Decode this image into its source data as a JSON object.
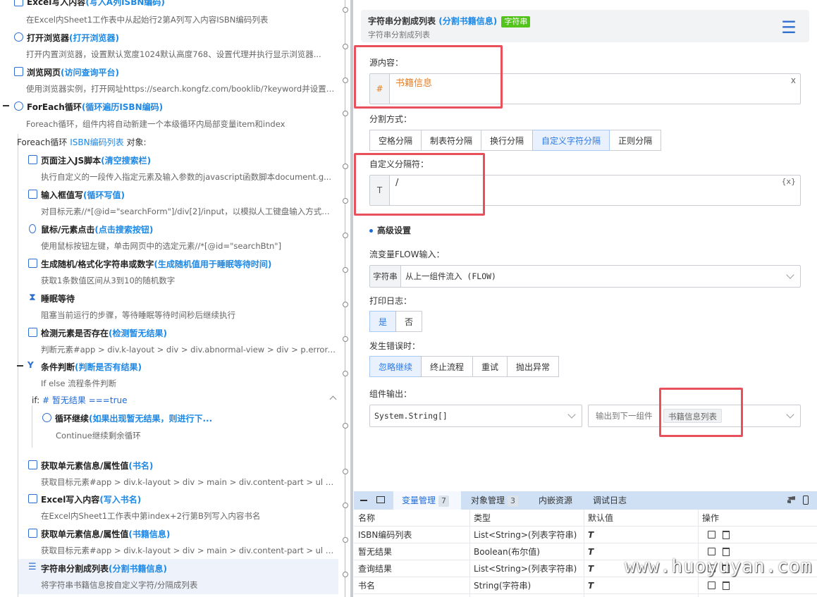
{
  "left_steps": [
    {
      "title": "Excel写入内容",
      "alias": "(写入A列ISBN编码)",
      "desc": "在Excel内Sheet1工作表中从起始行2第A列写入内容ISBN编码列表",
      "icon": "excel-icon"
    },
    {
      "title": "打开浏览器",
      "alias": "(打开浏览器)",
      "desc": "打开内置浏览器，设置默认宽度1024默认高度768、设置代理并执行显示浏览器...",
      "icon": "compass-icon"
    },
    {
      "title": "浏览网页",
      "alias": "(访问查询平台)",
      "desc": "使用浏览器实例，打开网址https://search.kongfz.com/booklib/?keyword并设置U...",
      "icon": "browser-icon"
    },
    {
      "title": "ForEach循环",
      "alias": "(循环遍历ISBN编码)",
      "desc": "Foreach循环，组件内将自动新建一个本级循环内局部变量item和index",
      "icon": "loop-icon"
    }
  ],
  "foreach_object": {
    "prefix": "Foreach循环",
    "var": "ISBN编码列表",
    "suffix": "对象:"
  },
  "inner_steps": [
    {
      "title": "页面注入JS脚本",
      "alias": "(清空搜索栏)",
      "desc": "执行自定义的一段传入指定元素及输入参数的javascript函数脚本document.g...",
      "icon": "script-icon"
    },
    {
      "title": "输入框值写",
      "alias": "(循环写值)",
      "desc": "对目标元素//*[@id=\"searchForm\"]/div[2]/input，以模拟人工键盘输入方式写...",
      "icon": "input-icon"
    },
    {
      "title": "鼠标/元素点击",
      "alias": "(点击搜索按钮)",
      "desc": "使用鼠标按钮左键，单击网页中的选定元素//*[@id=\"searchBtn\"]",
      "icon": "mouse-icon"
    },
    {
      "title": "生成随机/格式化字符串或数字",
      "alias": "(生成随机值用于睡眠等待时间)",
      "desc": "获取1条数值区间从3到10的随机数字",
      "icon": "random-icon"
    },
    {
      "title": "睡眠等待",
      "alias": "",
      "desc": "阻塞当前运行的步骤，等待睡眠等待时间秒后继续执行",
      "icon": "hourglass-icon"
    },
    {
      "title": "检测元素是否存在",
      "alias": "(检测暂无结果)",
      "desc": "判断元素#app > div.k-layout > div > div.abnormal-view > div > p.error-title是...",
      "icon": "detect-icon"
    },
    {
      "title": "条件判断",
      "alias": "(判断是否有结果)",
      "desc": "If else 流程条件判断",
      "icon": "condition-icon"
    }
  ],
  "if_line": {
    "prefix": "if:",
    "expr": "# 暂无结果 ===true"
  },
  "loop_continue": {
    "title": "循环继续",
    "alias": "(如果出现暂无结果，则进行下...",
    "desc": "Continue继续剩余循环"
  },
  "after_steps": [
    {
      "title": "获取单元素信息/属性值",
      "alias": "(书名)",
      "desc": "获取目标元素#app > div.k-layout > div > main > div.content-part > ul > li > di...",
      "icon": "element-icon"
    },
    {
      "title": "Excel写入内容",
      "alias": "(写入书名)",
      "desc": "在Excel内Sheet1工作表中第index+2行第B列写入内容书名",
      "icon": "excel-icon"
    },
    {
      "title": "获取单元素信息/属性值",
      "alias": "(书籍信息)",
      "desc": "获取目标元素#app > div.k-layout > div > main > div.content-part > ul > li > di...",
      "icon": "element-icon"
    },
    {
      "title": "字符串分割成列表",
      "alias": "(分割书籍信息)",
      "desc": "将字符串书籍信息按自定义字符/分隔成列表",
      "icon": "split-icon"
    }
  ],
  "panel": {
    "title": "字符串分割成列表",
    "alias": "(分割书籍信息)",
    "type_tag": "字符串",
    "subtitle": "字符串分割成列表",
    "source_label": "源内容：",
    "source_prefix": "#",
    "source_value": "书籍信息",
    "source_clear": "x",
    "split_label": "分割方式：",
    "split_options": [
      "空格分隔",
      "制表符分隔",
      "换行分隔",
      "自定义字符分隔",
      "正则分隔"
    ],
    "split_selected": "自定义字符分隔",
    "sep_label": "自定义分隔符：",
    "sep_prefix": "T",
    "sep_value": "/",
    "sep_var": "{x}",
    "advanced_label": "高级设置",
    "flow_label": "流变量FLOW输入：",
    "flow_tag": "字符串",
    "flow_value": "从上一组件流入 (FLOW)",
    "log_label": "打印日志：",
    "log_options": [
      "是",
      "否"
    ],
    "log_selected": "是",
    "error_label": "发生错误时：",
    "error_options": [
      "忽略继续",
      "终止流程",
      "重试",
      "抛出异常"
    ],
    "error_selected": "忽略继续",
    "output_label": "组件输出：",
    "output_type": "System.String[]",
    "output_next_label": "输出到下一组件",
    "output_var": "书籍信息列表"
  },
  "bottom_panel": {
    "tabs": [
      {
        "label": "变量管理",
        "count": "7"
      },
      {
        "label": "对象管理",
        "count": "3"
      },
      {
        "label": "内嵌资源",
        "count": ""
      },
      {
        "label": "调试日志",
        "count": ""
      }
    ],
    "columns": [
      "名称",
      "类型",
      "默认值",
      "操作"
    ],
    "rows": [
      {
        "name": "ISBN编码列表",
        "type": "List<String>(列表字符串)",
        "default": "T"
      },
      {
        "name": "暂无结果",
        "type": "Boolean(布尔值)",
        "default": "T"
      },
      {
        "name": "查询结果",
        "type": "List<String>(列表字符串)",
        "default": "T"
      },
      {
        "name": "书名",
        "type": "String(字符串)",
        "default": "T"
      }
    ]
  },
  "watermark": "www.huoyuyan.com"
}
